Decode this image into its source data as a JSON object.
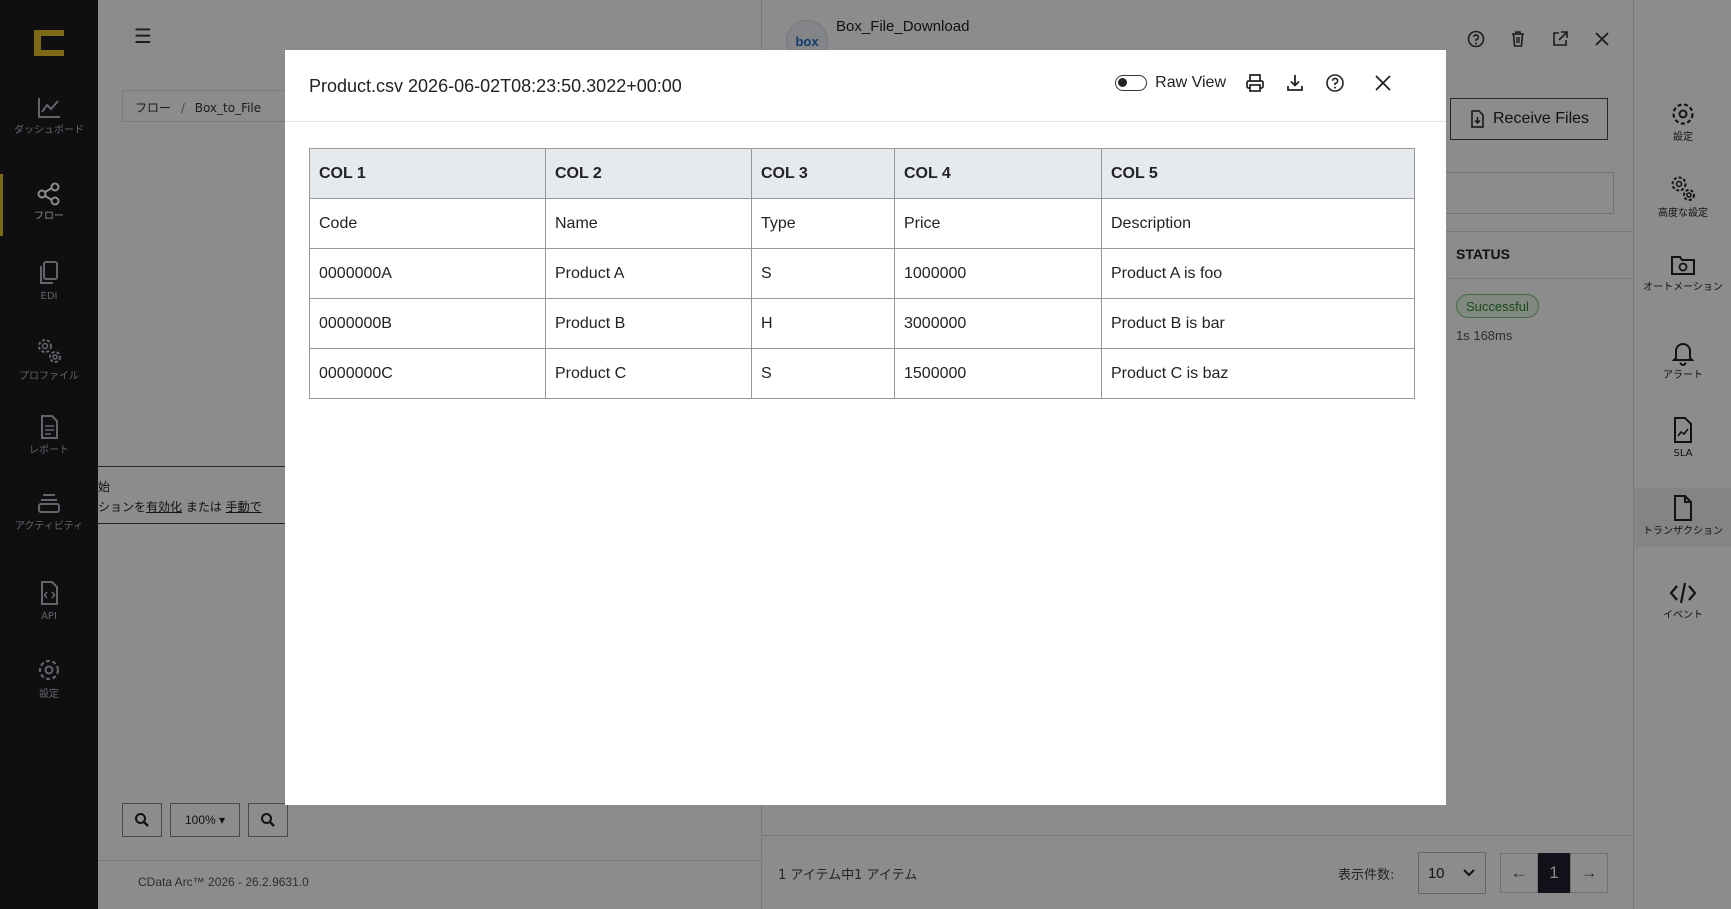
{
  "nav": {
    "items": [
      {
        "label": "ダッシュボード"
      },
      {
        "label": "フロー"
      },
      {
        "label": "EDI"
      },
      {
        "label": "プロファイル"
      },
      {
        "label": "レポート"
      },
      {
        "label": "アクティビティ"
      },
      {
        "label": "API"
      },
      {
        "label": "設定"
      }
    ]
  },
  "work": {
    "breadcrumb": {
      "root": "フロー",
      "sep": "/",
      "current": "Box_to_File"
    },
    "notice": {
      "line1": "始",
      "prefix": "ションを",
      "link1": "有効化",
      "middle": " または ",
      "link2": "手動で"
    },
    "zoom": {
      "level": "100%"
    },
    "version": "CData Arc™ 2026 - 26.2.9631.0"
  },
  "panel": {
    "avatar_text": "box",
    "title": "Box_File_Download",
    "receive_label": "Receive Files",
    "status_header": "STATUS",
    "status_value": "Successful",
    "duration": "1s 168ms",
    "count_text": "1 アイテム中1 アイテム",
    "perpage_label": "表示件数:",
    "perpage_value": "10",
    "page_current": "1"
  },
  "rail": {
    "items": [
      {
        "label": "設定"
      },
      {
        "label": "高度な設定"
      },
      {
        "label": "オートメーション"
      },
      {
        "label": "アラート"
      },
      {
        "label": "SLA"
      },
      {
        "label": "トランザクション"
      },
      {
        "label": "イベント"
      }
    ]
  },
  "modal": {
    "title": "Product.csv 2026-06-02T08:23:50.3022+00:00",
    "raw_view_label": "Raw View",
    "raw_view_on": false,
    "columns": [
      "COL 1",
      "COL 2",
      "COL 3",
      "COL 4",
      "COL 5"
    ],
    "rows": [
      [
        "Code",
        "Name",
        "Type",
        "Price",
        "Description"
      ],
      [
        "0000000A",
        "Product A",
        "S",
        "1000000",
        "Product A is foo"
      ],
      [
        "0000000B",
        "Product B",
        "H",
        "3000000",
        "Product B is bar"
      ],
      [
        "0000000C",
        "Product C",
        "S",
        "1500000",
        "Product C is baz"
      ]
    ]
  },
  "colors": {
    "accent": "#e3c12a",
    "nav_bg": "#1c1c22",
    "success": "#2f8a2f"
  }
}
